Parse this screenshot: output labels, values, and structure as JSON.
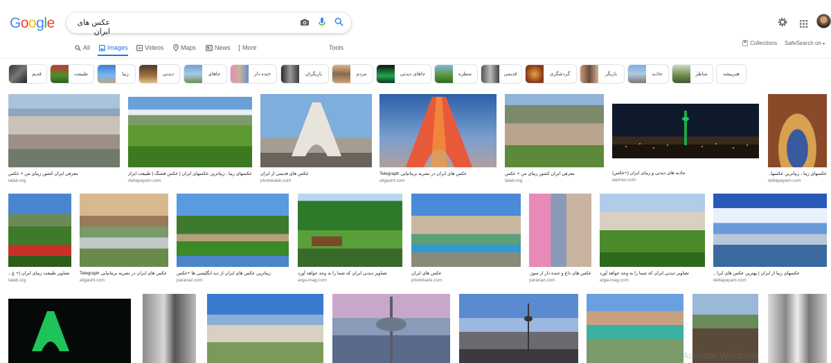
{
  "logo": {
    "letters": [
      "G",
      "o",
      "o",
      "g",
      "l",
      "e"
    ],
    "colors": [
      "#4285f4",
      "#ea4335",
      "#fbbc05",
      "#4285f4",
      "#34a853",
      "#ea4335"
    ]
  },
  "search": {
    "query": "عکس های ایران"
  },
  "tabs": [
    {
      "label": "All",
      "icon": "search-icon",
      "active": false
    },
    {
      "label": "Images",
      "icon": "image-icon",
      "active": true
    },
    {
      "label": "Videos",
      "icon": "video-icon",
      "active": false
    },
    {
      "label": "Maps",
      "icon": "map-pin-icon",
      "active": false
    },
    {
      "label": "News",
      "icon": "news-icon",
      "active": false
    },
    {
      "label": "More",
      "icon": "more-dots-icon",
      "active": false
    }
  ],
  "tools_label": "Tools",
  "collections_label": "Collections",
  "safesearch_label": "SafeSearch on",
  "accent": "#1a73e8",
  "chips": [
    "قدیم",
    "طبیعت",
    "زیبا",
    "دیدنی",
    "جاهای",
    "خنده دار",
    "بازیگران",
    "مردم",
    "جاهای دیدنی",
    "منظره",
    "قدیمی",
    "گردشگری",
    "بازیگر",
    "جاذبه",
    "مناظر",
    "هنرپیشه"
  ],
  "results_row1": [
    {
      "caption": "معرفی ایران کشور زیبای من + عکس",
      "source": "talab.org"
    },
    {
      "caption": "عکسهای زیبا ، زیباترین عکسهای ایران | عکس قشنگ | طبیعت ایران ...",
      "source": "deltapayam.com"
    },
    {
      "caption": "عکس های قدیمی از ایران",
      "source": "photokade.com"
    },
    {
      "caption": "عکس های ایران در نشریه بریتانیایی Telegraph",
      "source": "eligasht.com"
    },
    {
      "caption": "معرفی ایران کشور زیبای من + عکس",
      "source": "talab.org"
    },
    {
      "caption": "جاذبه های دیدنی و زیبای ایران (+عکس)",
      "source": "aariran.com"
    },
    {
      "caption": "عکسهای زیبا ، زیباترین عکسها...",
      "source": "deltapayam.com"
    }
  ],
  "results_row2": [
    {
      "caption": "تصاویر طبیعت زیبای ایران (+ ع...",
      "source": "talab.org"
    },
    {
      "caption": "عکس های ایران در نشریه بریتانیایی Telegraph",
      "source": "eligasht.com"
    },
    {
      "caption": "زیباترین عکس های ایران از دید انگلیسی ها +عکس",
      "source": "paranaz.com"
    },
    {
      "caption": "تصاویر دیدنی ایران که شما را به وجد خواهد آورد",
      "source": "arga-mag.com"
    },
    {
      "caption": "عکس های ایران",
      "source": "photokade.com"
    },
    {
      "caption": "عکس های داغ و خنده دار از سوژ...",
      "source": "paranaz.com"
    },
    {
      "caption": "تصاویر دیدنی ایران که شما را به وجد خواهد آورد",
      "source": "arga-mag.com"
    },
    {
      "caption": "عکسهای زیبا از ایران | بهترین عکس های ایرا...",
      "source": "deltapayam.com"
    }
  ],
  "watermark": "Activate Windows"
}
